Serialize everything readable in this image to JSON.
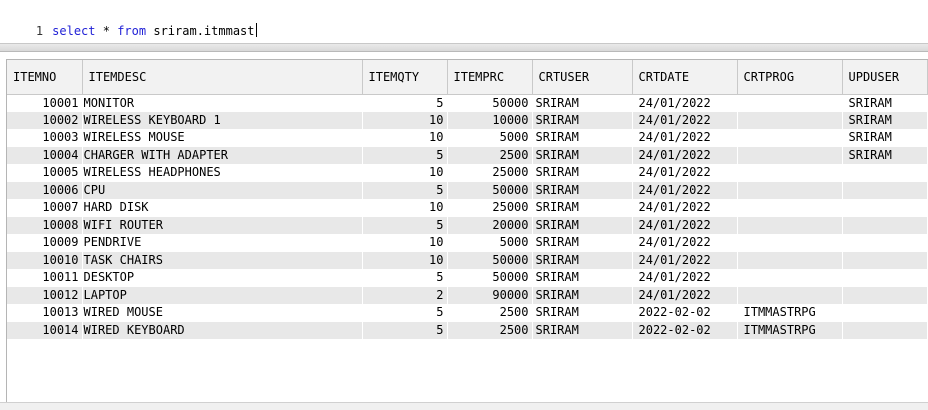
{
  "editor": {
    "line_number": "1",
    "kw_select": "select",
    "star": "*",
    "kw_from": "from",
    "table_name": "sriram.itmmast"
  },
  "grid": {
    "columns": [
      "ITEMNO",
      "ITEMDESC",
      "ITEMQTY",
      "ITEMPRC",
      "CRTUSER",
      "CRTDATE",
      "CRTPROG",
      "UPDUSER"
    ],
    "rows": [
      [
        "10001",
        "MONITOR",
        "5",
        "50000",
        "SRIRAM",
        "24/01/2022",
        "",
        "SRIRAM"
      ],
      [
        "10002",
        "WIRELESS KEYBOARD 1",
        "10",
        "10000",
        "SRIRAM",
        "24/01/2022",
        "",
        "SRIRAM"
      ],
      [
        "10003",
        "WIRELESS MOUSE",
        "10",
        "5000",
        "SRIRAM",
        "24/01/2022",
        "",
        "SRIRAM"
      ],
      [
        "10004",
        "CHARGER WITH ADAPTER",
        "5",
        "2500",
        "SRIRAM",
        "24/01/2022",
        "",
        "SRIRAM"
      ],
      [
        "10005",
        "WIRELESS HEADPHONES",
        "10",
        "25000",
        "SRIRAM",
        "24/01/2022",
        "",
        ""
      ],
      [
        "10006",
        "CPU",
        "5",
        "50000",
        "SRIRAM",
        "24/01/2022",
        "",
        ""
      ],
      [
        "10007",
        "HARD DISK",
        "10",
        "25000",
        "SRIRAM",
        "24/01/2022",
        "",
        ""
      ],
      [
        "10008",
        "WIFI ROUTER",
        "5",
        "20000",
        "SRIRAM",
        "24/01/2022",
        "",
        ""
      ],
      [
        "10009",
        "PENDRIVE",
        "10",
        "5000",
        "SRIRAM",
        "24/01/2022",
        "",
        ""
      ],
      [
        "10010",
        "TASK CHAIRS",
        "10",
        "50000",
        "SRIRAM",
        "24/01/2022",
        "",
        ""
      ],
      [
        "10011",
        "DESKTOP",
        "5",
        "50000",
        "SRIRAM",
        "24/01/2022",
        "",
        ""
      ],
      [
        "10012",
        "LAPTOP",
        "2",
        "90000",
        "SRIRAM",
        "24/01/2022",
        "",
        ""
      ],
      [
        "10013",
        "WIRED MOUSE",
        "5",
        "2500",
        "SRIRAM",
        "2022-02-02",
        "ITMMASTRPG",
        ""
      ],
      [
        "10014",
        "WIRED KEYBOARD",
        "5",
        "2500",
        "SRIRAM",
        "2022-02-02",
        "ITMMASTRPG",
        ""
      ]
    ]
  },
  "colors": {
    "keyword": "#1f1fd6",
    "row_alt": "#e8e8e8",
    "header_bg": "#f2f2f2"
  }
}
